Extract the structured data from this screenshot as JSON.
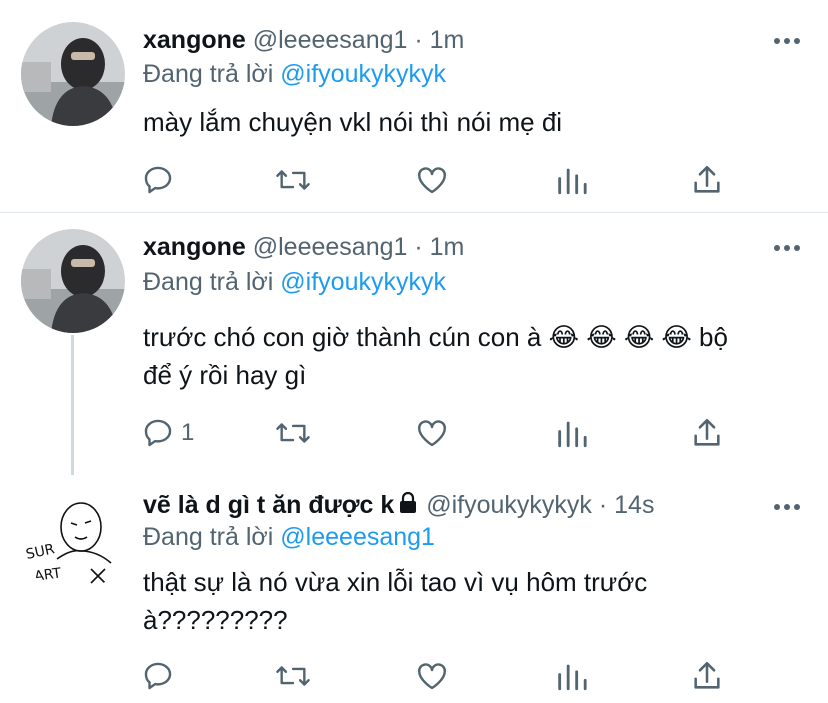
{
  "colors": {
    "link": "#1d9bf0",
    "secondary": "#536471",
    "text": "#0f1419",
    "divider": "#e1e8ed"
  },
  "tweets": [
    {
      "name": "xangone",
      "handle": "@leeeesang1",
      "separator": "·",
      "time": "1m",
      "replying_prefix": "Đang trả lời",
      "replying_to": "@ifyoukykykyk",
      "text": "mày lắm chuyện vkl nói thì nói mẹ đi",
      "actions": {
        "reply_count": "",
        "icons": [
          "reply-icon",
          "retweet-icon",
          "like-icon",
          "analytics-icon",
          "share-icon"
        ]
      }
    },
    {
      "name": "xangone",
      "handle": "@leeeesang1",
      "separator": "·",
      "time": "1m",
      "replying_prefix": "Đang trả lời",
      "replying_to": "@ifyoukykykyk",
      "text_line1": "trước chó con giờ thành cún con à 😂 😂 😂 😂  bộ",
      "text_line2": "để ý rồi hay gì",
      "actions": {
        "reply_count": "1"
      }
    },
    {
      "name": "vẽ là d gì t ăn được k",
      "handle": "@ifyoukykykyk",
      "separator": "·",
      "time": "14s",
      "replying_prefix": "Đang trả lời",
      "replying_to": "@leeeesang1",
      "text_line1": "thật sự là nó vừa xin lỗi tao vì vụ hôm trước",
      "text_line2": "à?????????",
      "actions": {
        "reply_count": ""
      }
    }
  ]
}
